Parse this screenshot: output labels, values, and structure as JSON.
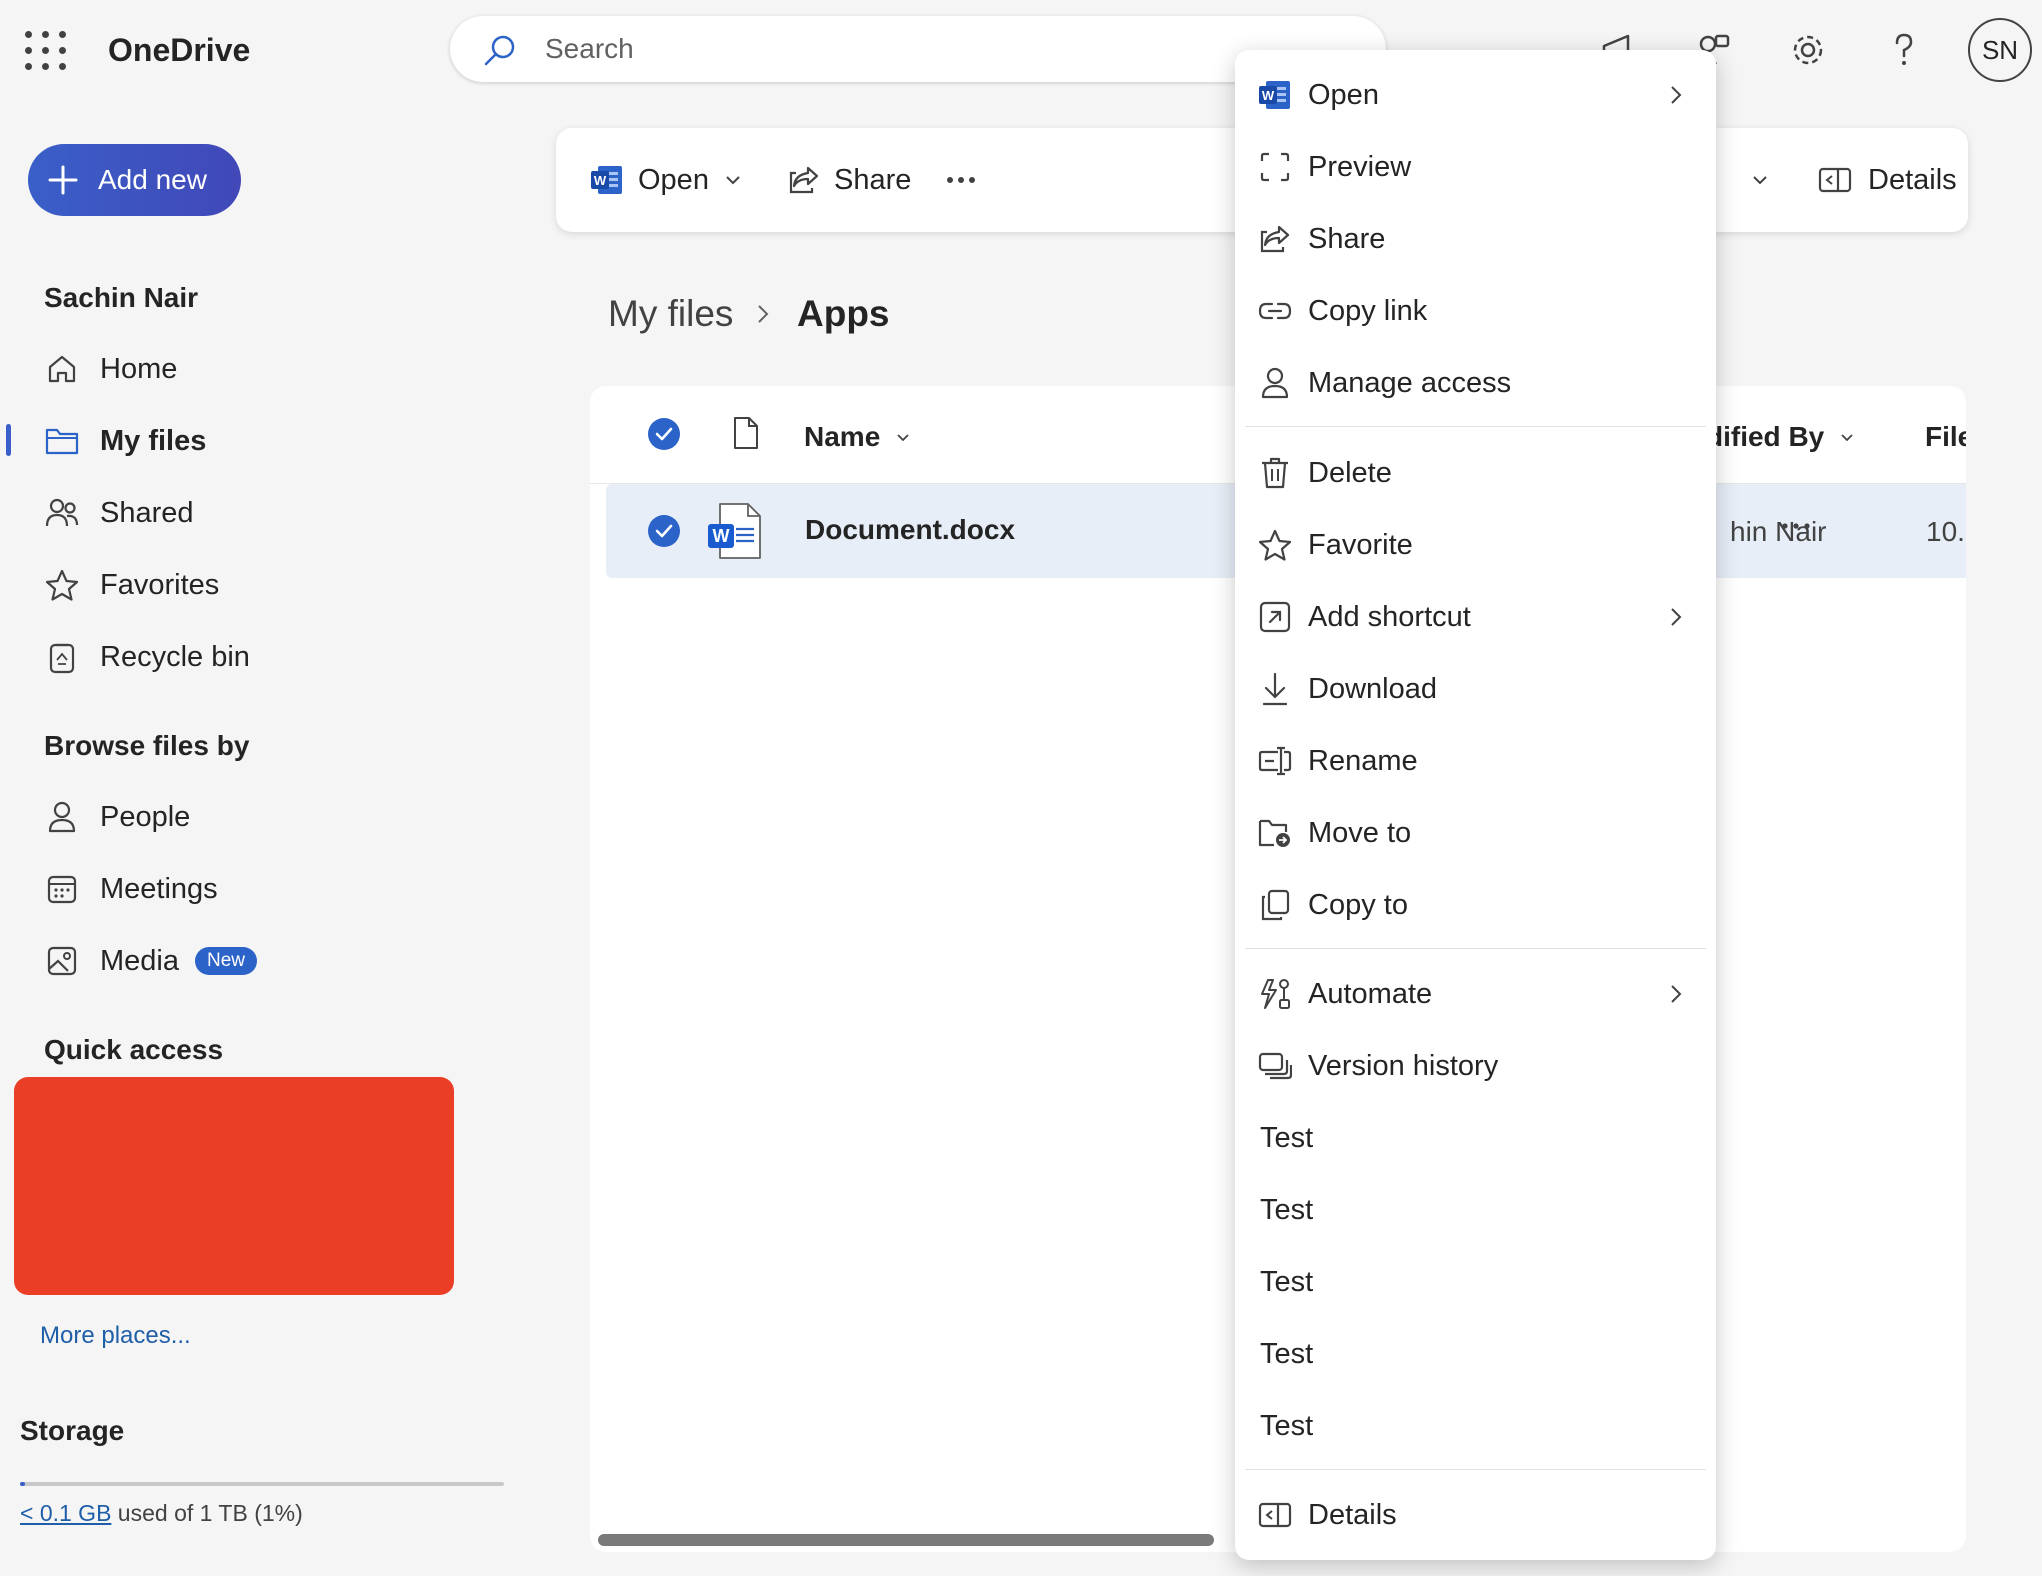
{
  "app": {
    "title": "OneDrive"
  },
  "search": {
    "placeholder": "Search"
  },
  "user": {
    "initials": "SN",
    "name": "Sachin Nair"
  },
  "sidebar": {
    "add_new": "Add new",
    "user_section": "Sachin Nair",
    "items": [
      {
        "label": "Home",
        "icon": "home-icon"
      },
      {
        "label": "My files",
        "icon": "folder-icon",
        "active": true
      },
      {
        "label": "Shared",
        "icon": "people-icon"
      },
      {
        "label": "Favorites",
        "icon": "star-icon"
      },
      {
        "label": "Recycle bin",
        "icon": "recycle-bin-icon"
      }
    ],
    "browse_heading": "Browse files by",
    "browse_items": [
      {
        "label": "People",
        "icon": "person-icon"
      },
      {
        "label": "Meetings",
        "icon": "calendar-icon"
      },
      {
        "label": "Media",
        "icon": "image-icon",
        "badge": "New"
      }
    ],
    "quick_access_heading": "Quick access",
    "more_places": "More places...",
    "storage": {
      "title": "Storage",
      "used_link": "< 0.1 GB",
      "used_text": " used of 1 TB (1%)",
      "percent": 1
    }
  },
  "command_bar": {
    "open": "Open",
    "share": "Share",
    "details": "Details"
  },
  "breadcrumb": {
    "parent": "My files",
    "current": "Apps"
  },
  "file_list": {
    "columns": {
      "name": "Name",
      "modified_by": "dified By",
      "file_size": "File"
    },
    "rows": [
      {
        "name": "Document.docx",
        "modified_by": "hin Nair",
        "file_size": "10.",
        "selected": true
      }
    ]
  },
  "context_menu": {
    "items": [
      {
        "label": "Open",
        "icon": "word-icon",
        "submenu": true
      },
      {
        "label": "Preview",
        "icon": "preview-icon"
      },
      {
        "label": "Share",
        "icon": "share-icon"
      },
      {
        "label": "Copy link",
        "icon": "link-icon"
      },
      {
        "label": "Manage access",
        "icon": "person-icon"
      },
      {
        "label": "Delete",
        "icon": "trash-icon"
      },
      {
        "label": "Favorite",
        "icon": "star-icon"
      },
      {
        "label": "Add shortcut",
        "icon": "shortcut-icon",
        "submenu": true
      },
      {
        "label": "Download",
        "icon": "download-icon"
      },
      {
        "label": "Rename",
        "icon": "rename-icon"
      },
      {
        "label": "Move to",
        "icon": "move-icon"
      },
      {
        "label": "Copy to",
        "icon": "copy-icon"
      },
      {
        "label": "Automate",
        "icon": "automate-icon",
        "submenu": true
      },
      {
        "label": "Version history",
        "icon": "version-history-icon"
      },
      {
        "label": "Test"
      },
      {
        "label": "Test"
      },
      {
        "label": "Test"
      },
      {
        "label": "Test"
      },
      {
        "label": "Test"
      },
      {
        "label": "Details",
        "icon": "details-icon"
      }
    ]
  },
  "colors": {
    "accent": "#3a5fc8",
    "selected_row": "#e8eef8",
    "quick_access_block": "#ea3f26",
    "link": "#1f5ea8"
  }
}
